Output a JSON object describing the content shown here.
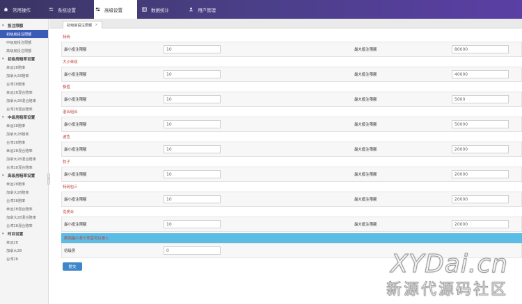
{
  "nav": {
    "items": [
      {
        "label": "常用操作",
        "icon": "home-icon"
      },
      {
        "label": "系统设置",
        "icon": "sliders-icon"
      },
      {
        "label": "高级设置",
        "icon": "sliders-icon"
      },
      {
        "label": "数据统计",
        "icon": "table-icon"
      },
      {
        "label": "用户管理",
        "icon": "user-icon"
      }
    ],
    "active_index": 2
  },
  "sidebar": {
    "groups": [
      {
        "title": "投注限额",
        "items": [
          "初级房投注限额",
          "中级房投注限额",
          "高级房投注限额"
        ]
      },
      {
        "title": "初级房赔率设置",
        "items": [
          "幸运28赔率",
          "加拿大28赔率",
          "台湾28赔率",
          "幸运28混合赔率",
          "加拿大28混合赔率",
          "台湾28混合赔率"
        ]
      },
      {
        "title": "中级房赔率设置",
        "items": [
          "幸运28赔率",
          "加拿大28赔率",
          "台湾28赔率",
          "幸运28混合赔率",
          "加拿大28混合赔率",
          "台湾28混合赔率"
        ]
      },
      {
        "title": "高级房赔率设置",
        "items": [
          "幸运28赔率",
          "加拿大28赔率",
          "台湾28赔率",
          "幸运28混合赔率",
          "加拿大28混合赔率",
          "台湾28混合赔率"
        ]
      },
      {
        "title": "时间设置",
        "items": [
          "幸运28",
          "加拿大28",
          "台湾28"
        ]
      }
    ],
    "active_item": "初级房投注限额"
  },
  "tab": {
    "label": "初级房投注限额"
  },
  "form": {
    "min_label": "最小投注限额",
    "max_label": "最大投注限额",
    "sections": [
      {
        "title": "特码",
        "min": "10",
        "max": "80000"
      },
      {
        "title": "大小单双",
        "min": "10",
        "max": "40000"
      },
      {
        "title": "极值",
        "min": "10",
        "max": "5000"
      },
      {
        "title": "混合组合",
        "min": "10",
        "max": "50000"
      },
      {
        "title": "波色",
        "min": "10",
        "max": "20000"
      },
      {
        "title": "豹子",
        "min": "10",
        "max": "20000"
      },
      {
        "title": "特码包三",
        "min": "10",
        "max": "20000"
      },
      {
        "title": "龙虎合",
        "min": "10",
        "max": "20000"
      }
    ],
    "banner": "房间最小多少乐豆可以进入",
    "room_label": "初级房",
    "room_value": "0",
    "submit_label": "提交"
  },
  "watermark": {
    "main": "XYDai.cn",
    "sub": "新源代源码社区"
  },
  "colors": {
    "nav_bg": "#4a3f86",
    "active_item": "#3b5bb8",
    "section_title": "#c0392b",
    "banner": "#5bbce6",
    "button": "#3f86c9"
  }
}
